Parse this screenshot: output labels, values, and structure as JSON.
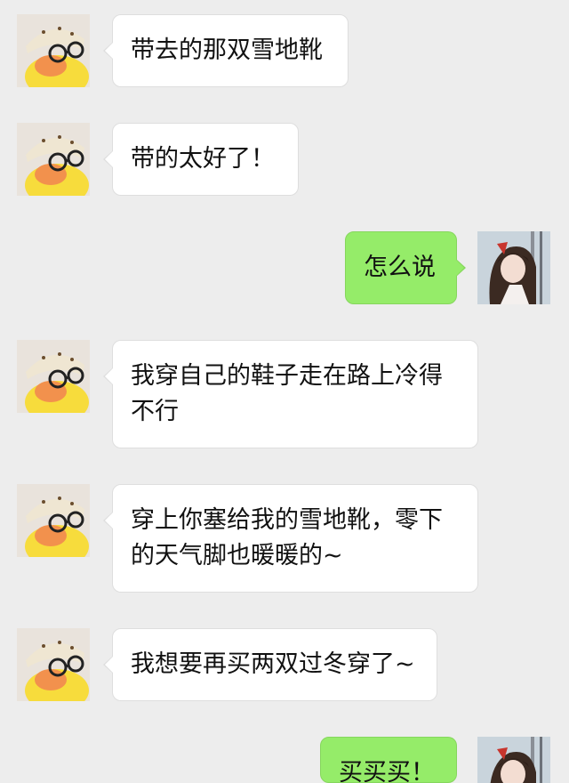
{
  "messages": [
    {
      "side": "left",
      "avatar": "duck-avatar",
      "text": "带去的那双雪地靴"
    },
    {
      "side": "left",
      "avatar": "duck-avatar",
      "text": "带的太好了！"
    },
    {
      "side": "right",
      "avatar": "anime-girl-avatar",
      "text": "怎么说"
    },
    {
      "side": "left",
      "avatar": "duck-avatar",
      "text": "我穿自己的鞋子走在路上冷得不行"
    },
    {
      "side": "left",
      "avatar": "duck-avatar",
      "text": "穿上你塞给我的雪地靴，零下的天气脚也暖暖的~"
    },
    {
      "side": "left",
      "avatar": "duck-avatar",
      "text": "我想要再买两双过冬穿了~"
    },
    {
      "side": "right",
      "avatar": "anime-girl-avatar",
      "text": "买买买！"
    }
  ],
  "colors": {
    "background": "#ededed",
    "incoming_bubble": "#ffffff",
    "outgoing_bubble": "#95ec69"
  }
}
